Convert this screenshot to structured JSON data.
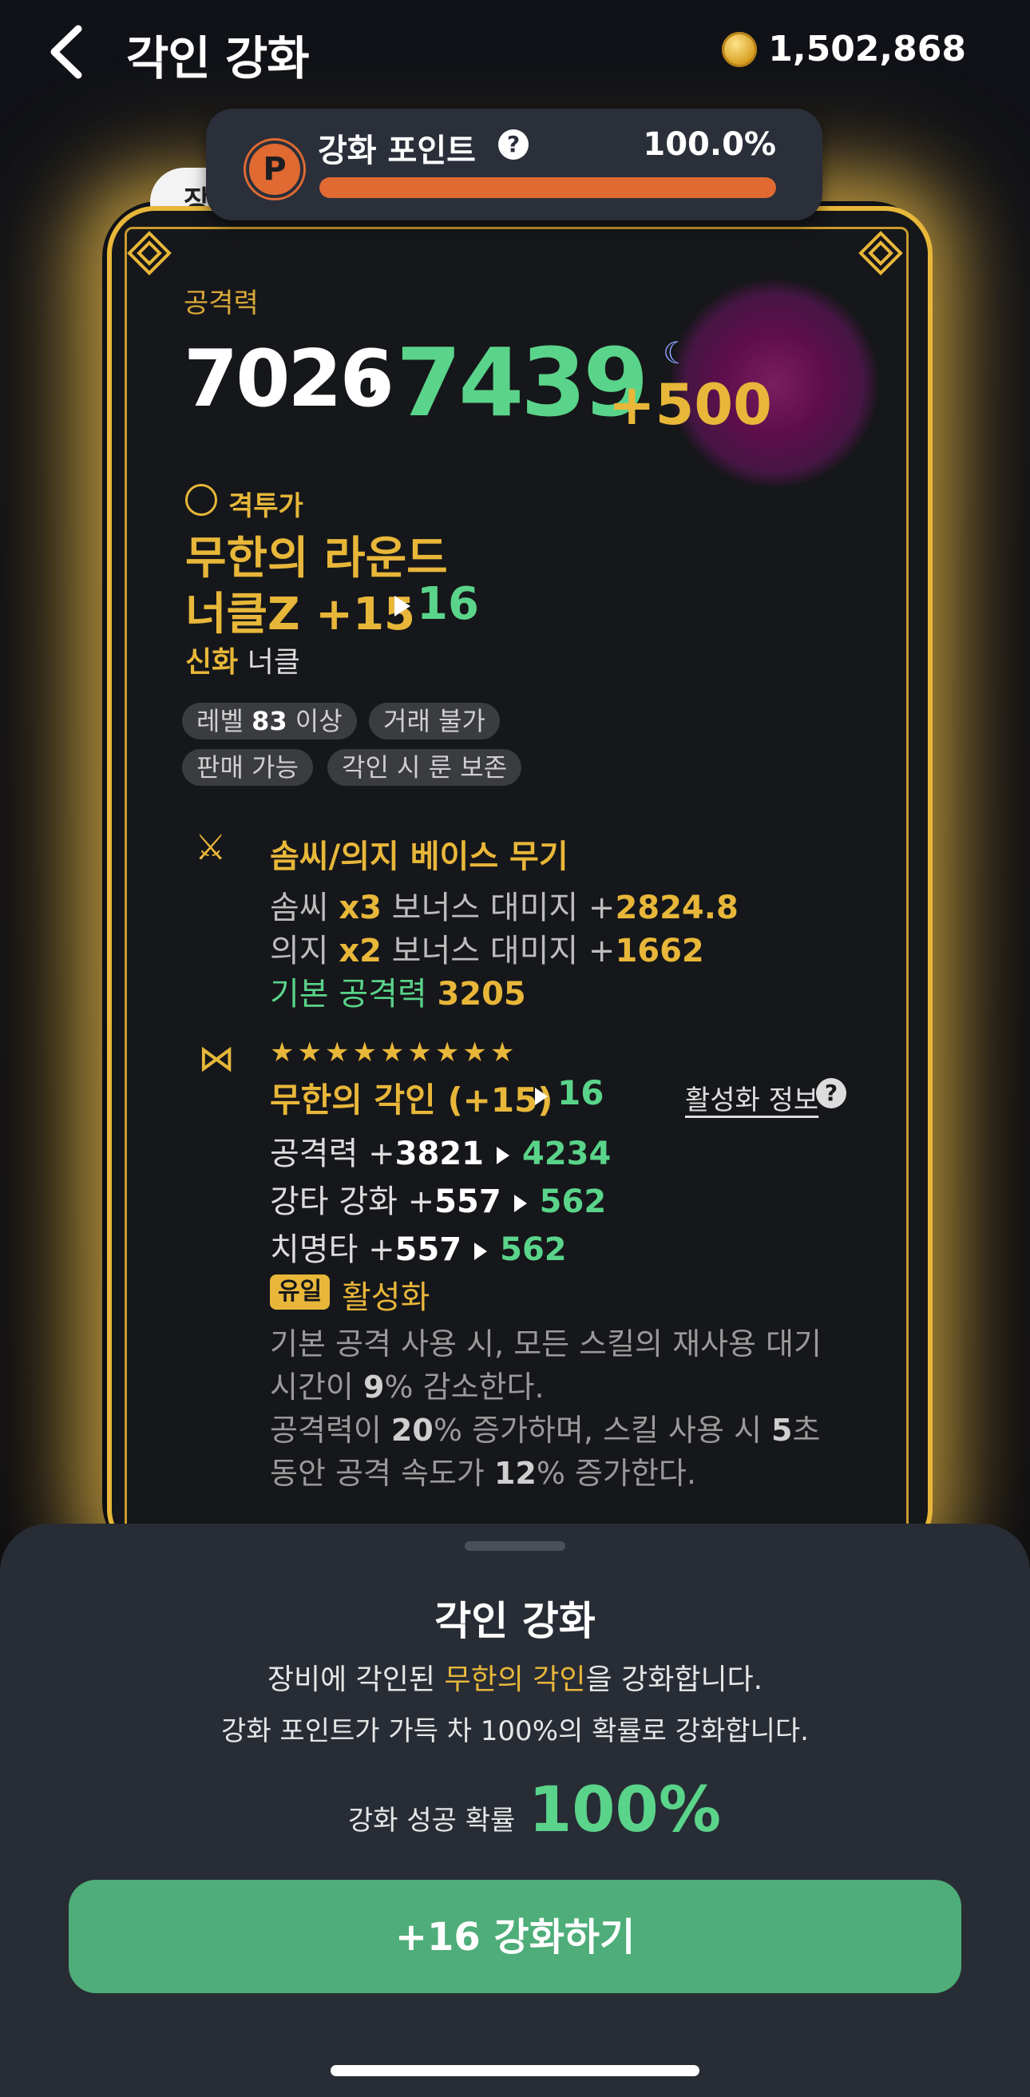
{
  "header": {
    "title": "각인 강화",
    "gold": "1,502,868"
  },
  "points": {
    "badge": "P",
    "label": "강화 포인트",
    "help": "?",
    "percent_text": "100.0%",
    "fill": 1.0
  },
  "tab": {
    "label": "장"
  },
  "item": {
    "attack_label": "공격력",
    "attack_old": "7026",
    "attack_new": "7439",
    "attack_bonus": "+500",
    "class": "격투가",
    "name_line1": "무한의 라운드",
    "name_line2": "너클Z +15",
    "name_line2_new": "16",
    "tier": "신화",
    "type": "너클",
    "chips": [
      {
        "pre": "레벨 ",
        "bold": "83",
        "post": " 이상"
      },
      {
        "pre": "거래 불가",
        "bold": "",
        "post": ""
      },
      {
        "pre": "판매 가능",
        "bold": "",
        "post": ""
      },
      {
        "pre": "각인 시 룬 보존",
        "bold": "",
        "post": ""
      }
    ]
  },
  "weapon_section": {
    "title": "솜씨/의지 베이스 무기",
    "rows": [
      {
        "a": "솜씨 ",
        "b": "x3",
        "c": " 보너스 대미지 +",
        "d": "2824.8"
      },
      {
        "a": "의지 ",
        "b": "x2",
        "c": " 보너스 대미지 +",
        "d": "1662"
      },
      {
        "a": "기본 공격력 ",
        "b": "3205",
        "c": "",
        "d": ""
      }
    ]
  },
  "engraving": {
    "stars": "★★★★★★★★★",
    "name": "무한의 각인 (+15)",
    "name_new": "16",
    "info_link": "활성화 정보",
    "info_help": "?",
    "stats": [
      {
        "label": "공격력 +",
        "old": "3821",
        "new": "4234"
      },
      {
        "label": "강타 강화 +",
        "old": "557",
        "new": "562"
      },
      {
        "label": "치명타 +",
        "old": "557",
        "new": "562"
      }
    ],
    "unique_badge": "유일",
    "active_label": "활성화",
    "desc": [
      {
        "a": "기본 공격 사용 시, 모든 스킬의 재사용 대기",
        "b": "",
        "c": "",
        "d": "",
        "e": ""
      },
      {
        "a": "시간이 ",
        "b": "9",
        "c": "% 감소한다.",
        "d": "",
        "e": ""
      },
      {
        "a": "공격력이 ",
        "b": "20",
        "c": "% 증가하며, 스킬 사용 시 ",
        "d": "5",
        "e": "초"
      },
      {
        "a": "동안 공격 속도가 ",
        "b": "12",
        "c": "% 증가한다.",
        "d": "",
        "e": ""
      }
    ]
  },
  "sheet": {
    "title": "각인 강화",
    "line1_pre": "장비에 각인된 ",
    "line1_hl": "무한의 각인",
    "line1_post": "을 강화합니다.",
    "line2": "강화 포인트가 가득 차 100%의 확률로 강화합니다.",
    "prob_label": "강화 성공 확률",
    "prob_value": "100%",
    "button": "+16 강화하기"
  },
  "colors": {
    "gold": "#e8b73a",
    "green": "#5ad48a",
    "orange": "#e06a32",
    "button": "#4ead78",
    "sheet": "#282c35"
  },
  "icons": [
    "back-arrow-icon",
    "coin-icon",
    "help-icon",
    "class-icon",
    "weapon-icon",
    "rune-icon",
    "knot-ornament-icon"
  ]
}
